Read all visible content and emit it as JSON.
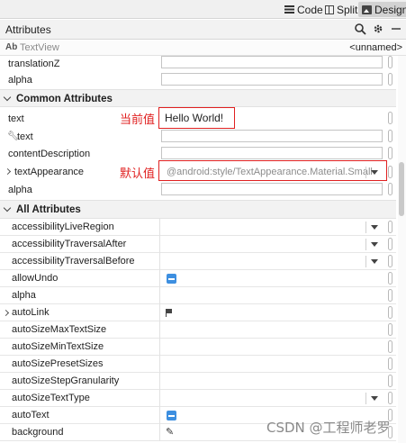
{
  "toolbar": {
    "code_label": "Code",
    "split_label": "Split",
    "design_label": "Design"
  },
  "panel": {
    "title": "Attributes",
    "component_icon": "Ab",
    "component_type": "TextView",
    "component_id": "<unnamed>"
  },
  "top_rows": [
    {
      "label": "translationZ"
    },
    {
      "label": "alpha"
    }
  ],
  "common": {
    "title": "Common Attributes",
    "text_label": "text",
    "text_value": "Hello World!",
    "tools_text_label": "text",
    "content_description_label": "contentDescription",
    "text_appearance_label": "textAppearance",
    "text_appearance_value": "@android:style/TextAppearance.Material.Small",
    "alpha_label": "alpha"
  },
  "annotations": {
    "current_value": "当前值",
    "default_value": "默认值"
  },
  "all": {
    "title": "All Attributes",
    "rows": [
      {
        "label": "accessibilityLiveRegion",
        "control": "dropdown"
      },
      {
        "label": "accessibilityTraversalAfter",
        "control": "dropdown"
      },
      {
        "label": "accessibilityTraversalBefore",
        "control": "dropdown"
      },
      {
        "label": "allowUndo",
        "control": "checkbox"
      },
      {
        "label": "alpha",
        "control": "none"
      },
      {
        "label": "autoLink",
        "control": "flag"
      },
      {
        "label": "autoSizeMaxTextSize",
        "control": "none"
      },
      {
        "label": "autoSizeMinTextSize",
        "control": "none"
      },
      {
        "label": "autoSizePresetSizes",
        "control": "none"
      },
      {
        "label": "autoSizeStepGranularity",
        "control": "none"
      },
      {
        "label": "autoSizeTextType",
        "control": "dropdown"
      },
      {
        "label": "autoText",
        "control": "checkbox"
      },
      {
        "label": "background",
        "control": "picker"
      }
    ]
  },
  "watermark": "CSDN @工程师老罗",
  "colors": {
    "accent_checkbox": "#3d8fe0",
    "annotation_red": "#e02020"
  }
}
